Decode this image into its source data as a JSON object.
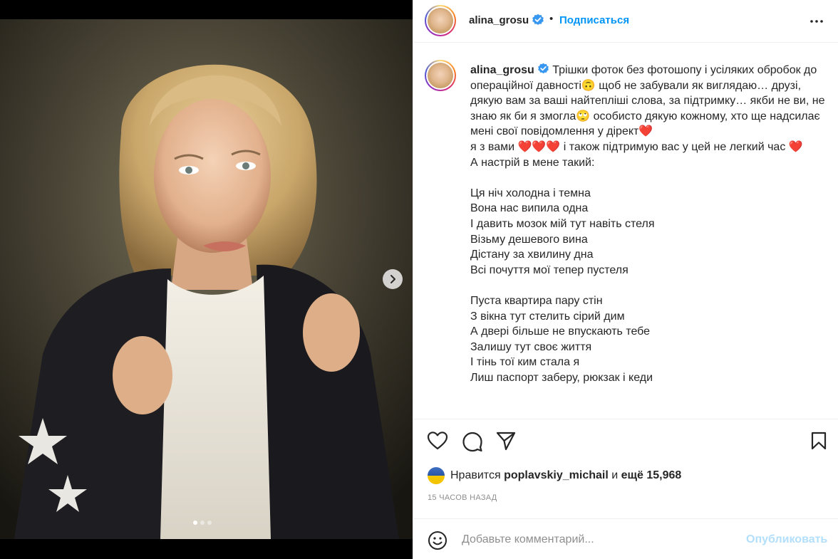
{
  "post": {
    "username": "alina_grosu",
    "follow_label": "Подписаться",
    "separator": "•",
    "carousel": {
      "slide_count": 3,
      "active_index": 0
    }
  },
  "caption": {
    "username": "alina_grosu",
    "text": "Трішки фоток без фотошопу і усіляких обробок до операційної давності🙃 щоб не забували як виглядаю… друзі, дякую вам за ваші найтепліші слова, за підтримку… якби не ви, не знаю як би я змогла🙄 особисто дякую кожному, хто ще надсилає мені свої повідомлення у дірект❤️\nя з вами ❤️❤️❤️ і також підтримую вас у цей не легкий час ❤️\nА настрій в мене такий:\n\nЦя ніч холодна і темна\nВона нас випила одна\nІ давить мозок мій тут навіть стеля\nВізьму дешевого вина\nДістану за хвилину дна\nВсі почуття мої тепер пустеля\n\nПуста квартира пару стін\nЗ вікна тут стелить сірий дим\nА двері більше не впускають тебе\nЗалишу тут своє життя\nІ тінь тої ким стала я\nЛиш паспорт заберу, рюкзак і кеди"
  },
  "likes": {
    "prefix": "Нравится",
    "user": "poplavskiy_michail",
    "conjunction": "и",
    "more": "ещё 15,968"
  },
  "timestamp": "15 ЧАСОВ НАЗАД",
  "comment": {
    "placeholder": "Добавьте комментарий...",
    "publish_label": "Опубликовать"
  },
  "icons": {
    "like": "heart-icon",
    "comment": "comment-icon",
    "share": "paper-plane-icon",
    "save": "bookmark-icon",
    "emoji": "smiley-icon",
    "more": "ellipsis-icon",
    "verified": "verified-badge-icon",
    "next": "chevron-right-icon"
  },
  "colors": {
    "accent": "#0095f6",
    "verified": "#3897f0",
    "publish_disabled": "#b2dffc"
  }
}
